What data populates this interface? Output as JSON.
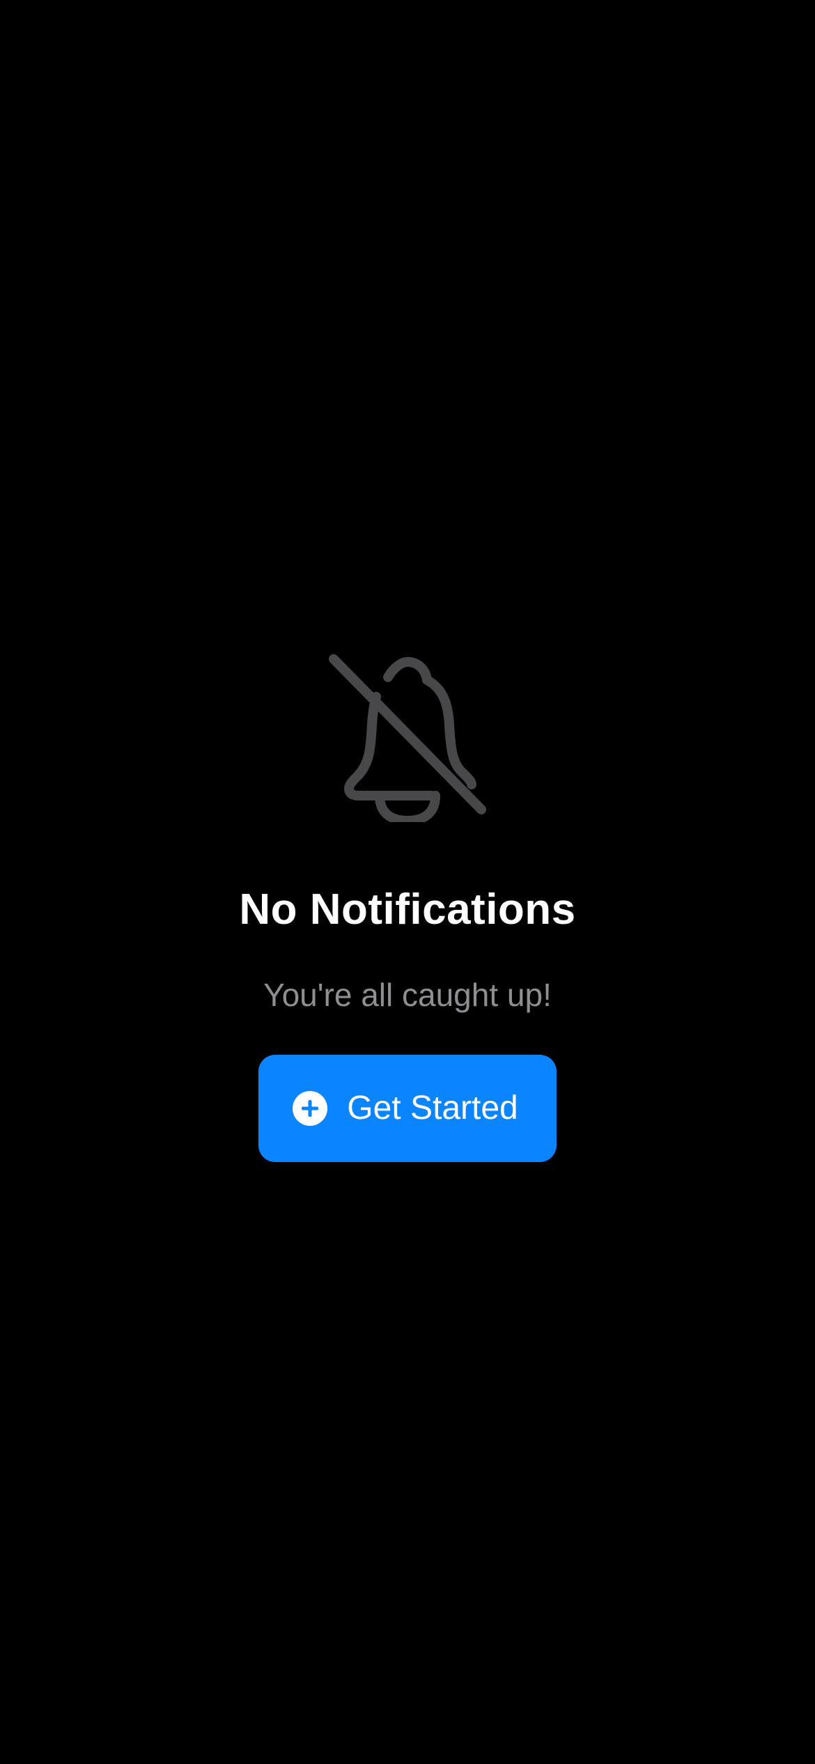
{
  "empty_state": {
    "icon": "bell-slash-icon",
    "title": "No Notifications",
    "subtitle": "You're all caught up!",
    "cta": {
      "icon": "plus-circle-icon",
      "label": "Get Started"
    }
  },
  "colors": {
    "background": "#000000",
    "title": "#ffffff",
    "subtitle": "#8e8e93",
    "icon": "#48484a",
    "accent": "#0a84ff"
  }
}
